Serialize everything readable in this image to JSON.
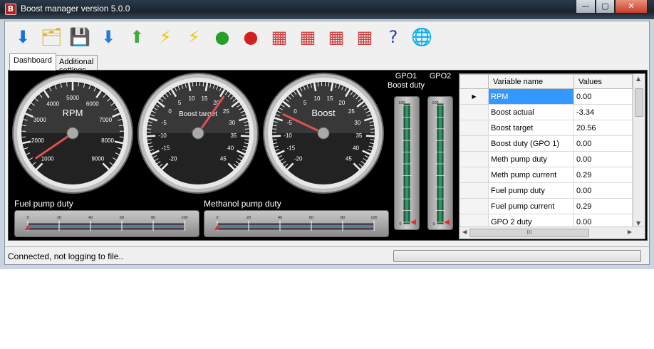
{
  "window": {
    "title": "Boost manager version 5.0.0",
    "icon": "app-icon"
  },
  "toolbar": {
    "buttons": [
      {
        "name": "download-icon",
        "glyph": "⬇",
        "color": "#1a6ed8"
      },
      {
        "name": "folder-refresh-icon",
        "glyph": "🗂",
        "color": "#d8b020"
      },
      {
        "name": "save-icon",
        "glyph": "💾",
        "color": "#3060b0"
      },
      {
        "name": "arrow-down-icon",
        "glyph": "⬇",
        "color": "#2c7ad8"
      },
      {
        "name": "arrow-up-icon",
        "glyph": "⬆",
        "color": "#3cae3c"
      },
      {
        "name": "lightning-circle-icon",
        "glyph": "⚡",
        "color": "#f0c000"
      },
      {
        "name": "lightning-icon",
        "glyph": "⚡",
        "color": "#e6c800"
      },
      {
        "name": "play-green-icon",
        "glyph": "●",
        "color": "#28a028"
      },
      {
        "name": "stop-red-icon",
        "glyph": "●",
        "color": "#d02020"
      },
      {
        "name": "map-3d-icon-1",
        "glyph": "▦",
        "color": "#d04040"
      },
      {
        "name": "map-3d-icon-2",
        "glyph": "▦",
        "color": "#d04040"
      },
      {
        "name": "map-3d-icon-3",
        "glyph": "▦",
        "color": "#d04040"
      },
      {
        "name": "map-3d-icon-4",
        "glyph": "▦",
        "color": "#d04040"
      },
      {
        "name": "help-icon",
        "glyph": "?",
        "color": "#2040c0"
      },
      {
        "name": "globe-update-icon",
        "glyph": "🌐",
        "color": "#2a80c0"
      }
    ]
  },
  "tabs": [
    {
      "label": "Dashboard",
      "active": true
    },
    {
      "label": "Additional settings",
      "active": false
    }
  ],
  "gauges": [
    {
      "label": "RPM",
      "ticks": [
        "1000",
        "2000",
        "3000",
        "4000",
        "5000",
        "6000",
        "7000",
        "8000",
        "9000"
      ],
      "value_fraction": 0.04
    },
    {
      "label": "Boost target",
      "ticks": [
        "-20",
        "-15",
        "-10",
        "-5",
        "0",
        "5",
        "10",
        "15",
        "20",
        "25",
        "30",
        "35",
        "40",
        "45"
      ],
      "value_fraction": 0.63
    },
    {
      "label": "Boost",
      "ticks": [
        "-20",
        "-15",
        "-10",
        "-5",
        "0",
        "5",
        "10",
        "15",
        "20",
        "25",
        "30",
        "35",
        "40",
        "45"
      ],
      "value_fraction": 0.26
    }
  ],
  "bars": {
    "fuel_title": "Fuel pump duty",
    "meth_title": "Methanol pump duty",
    "scale": [
      "0",
      "20",
      "40",
      "60",
      "80",
      "100"
    ]
  },
  "gpo": {
    "gpo1_title": "GPO1",
    "gpo1_sub": "Boost duty",
    "gpo2_title": "GPO2",
    "scale_top": "100",
    "scale_bottom": "0"
  },
  "grid": {
    "col_name": "Variable name",
    "col_value": "Values",
    "rows": [
      {
        "name": "RPM",
        "value": "0.00",
        "selected": true
      },
      {
        "name": "Boost actual",
        "value": "-3.34"
      },
      {
        "name": "Boost target",
        "value": "20.56"
      },
      {
        "name": "Boost duty (GPO 1)",
        "value": "0.00"
      },
      {
        "name": "Meth pump duty",
        "value": "0.00"
      },
      {
        "name": "Meth pump current",
        "value": "0.29"
      },
      {
        "name": "Fuel pump duty",
        "value": "0.00"
      },
      {
        "name": "Fuel pump current",
        "value": "0.29"
      },
      {
        "name": "GPO 2 duty",
        "value": "0.00"
      }
    ],
    "hscroll_glyph": "III"
  },
  "status": {
    "text": "Connected, not logging to file.."
  },
  "colors": {
    "selection": "#3399ff",
    "needle": "#e05050",
    "bar_fill": "#40c090"
  }
}
